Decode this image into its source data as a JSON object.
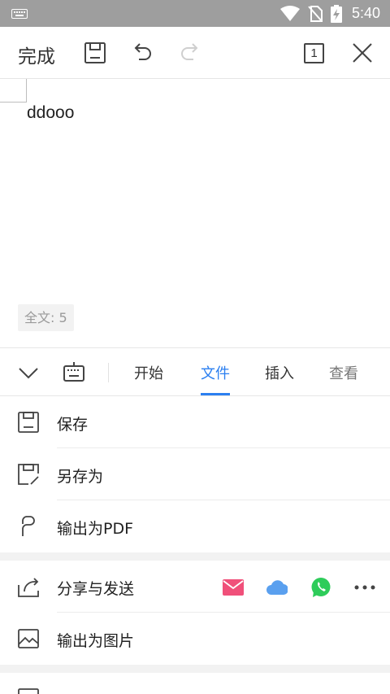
{
  "status_bar": {
    "time": "5:40"
  },
  "toolbar": {
    "done_label": "完成",
    "page_indicator": "1"
  },
  "document": {
    "text": "ddooo",
    "word_count": "全文: 5"
  },
  "tabs": [
    {
      "label": "开始"
    },
    {
      "label": "文件"
    },
    {
      "label": "插入"
    },
    {
      "label": "查看"
    }
  ],
  "active_tab": "文件",
  "menu": {
    "save": "保存",
    "save_as": "另存为",
    "export_pdf": "输出为PDF",
    "share": "分享与发送",
    "export_image": "输出为图片"
  },
  "colors": {
    "accent": "#2b7ff0",
    "mail": "#f0507a",
    "cloud": "#5aa0ef",
    "whatsapp": "#2ecc5a"
  }
}
